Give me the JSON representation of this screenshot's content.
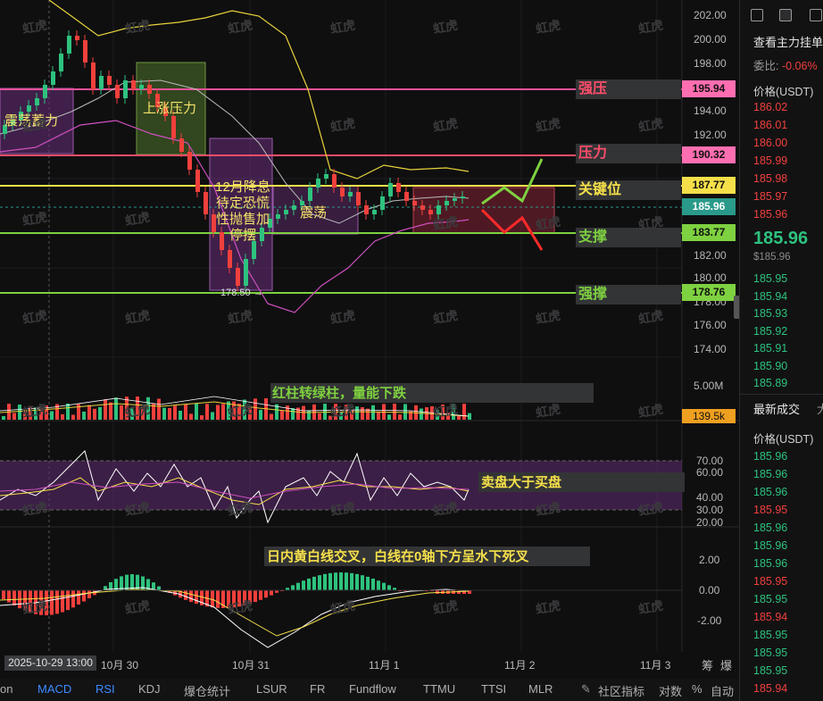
{
  "price_axis": [
    "202.00",
    "200.00",
    "198.00",
    "196.00",
    "194.00",
    "192.00",
    "190.00",
    "188.00",
    "186.00",
    "184.00",
    "182.00",
    "180.00",
    "178.00",
    "176.00",
    "174.00"
  ],
  "levels": [
    {
      "label": "强压",
      "price": "195.94",
      "color": "#e8509a",
      "tag_bg": "#ff6eb0"
    },
    {
      "label": "压力",
      "price": "190.32",
      "color": "#ff4d6a",
      "tag_bg": "#ff6eb0"
    },
    {
      "label": "关键位",
      "price": "187.77",
      "color": "#f5e04a",
      "tag_bg": "#f5e04a"
    },
    {
      "label": "支撑",
      "price": "183.77",
      "color": "#7ed140",
      "tag_bg": "#7ed140"
    },
    {
      "label": "强撑",
      "price": "178.76",
      "color": "#7ed140",
      "tag_bg": "#7ed140"
    }
  ],
  "current_price_tag": "185.96",
  "boxes": {
    "consolidation_accumulate": "震荡蓄力",
    "rising_pressure": "上涨压力",
    "dec_rate_cut": [
      "12月降息",
      "待定恐慌",
      "性抛售加",
      "停摆"
    ],
    "consolidation": "震荡"
  },
  "low_marker": "178.50 →",
  "volume": {
    "axis_top": "5.00M",
    "current": "139.5k"
  },
  "annotations": {
    "volume_note": "红柱转绿柱，量能下跌",
    "rsi_note": "卖盘大于买盘",
    "macd_note": "日内黄白线交叉，白线在0轴下方呈水下死叉"
  },
  "rsi_axis": [
    "70.00",
    "60.00",
    "40.00",
    "30.00",
    "20.00"
  ],
  "macd_axis": [
    "2.00",
    "0.00",
    "-2.00"
  ],
  "dates": {
    "cursor": "2025-10-29 13:00",
    "labels": [
      "10月 30",
      "10月 31",
      "11月 1",
      "11月 2",
      "11月 3"
    ]
  },
  "bottom_tabs": [
    "on",
    "MACD",
    "RSI",
    "KDJ",
    "爆仓统计",
    "LSUR",
    "FR",
    "Fundflow",
    "TTMU",
    "TTSI",
    "MLR"
  ],
  "bottom_right": [
    "社区指标",
    "对数",
    "%",
    "自动"
  ],
  "side_top_right": [
    "筹",
    "爆"
  ],
  "side": {
    "title": "查看主力挂单",
    "change_label": "委比:",
    "change_value": "-0.06%",
    "price_header": "价格(USDT)",
    "asks": [
      "186.02",
      "186.01",
      "186.00",
      "185.99",
      "185.98",
      "185.97",
      "185.96"
    ],
    "last_price": "185.96",
    "last_price_sub": "$185.96",
    "bids": [
      "185.95",
      "185.94",
      "185.93",
      "185.92",
      "185.91",
      "185.90",
      "185.89"
    ],
    "trades_header": "最新成交",
    "trades_header2": "大",
    "trades_price_header": "价格(USDT)",
    "trades": [
      {
        "p": "185.96",
        "c": "green"
      },
      {
        "p": "185.96",
        "c": "green"
      },
      {
        "p": "185.96",
        "c": "green"
      },
      {
        "p": "185.95",
        "c": "red"
      },
      {
        "p": "185.96",
        "c": "green"
      },
      {
        "p": "185.96",
        "c": "green"
      },
      {
        "p": "185.96",
        "c": "green"
      },
      {
        "p": "185.95",
        "c": "red"
      },
      {
        "p": "185.95",
        "c": "green"
      },
      {
        "p": "185.94",
        "c": "red"
      },
      {
        "p": "185.95",
        "c": "green"
      },
      {
        "p": "185.95",
        "c": "green"
      },
      {
        "p": "185.95",
        "c": "green"
      },
      {
        "p": "185.94",
        "c": "red"
      }
    ]
  },
  "watermark": "虹虎"
}
